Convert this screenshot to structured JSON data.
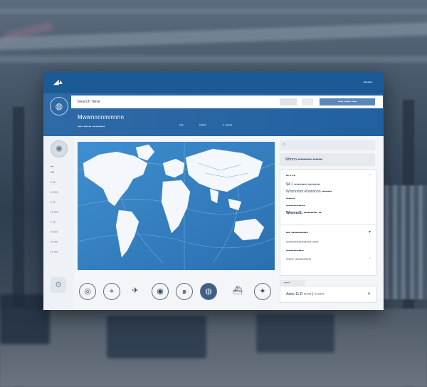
{
  "app": {
    "topbar_text": "▪▪▪▪▪▪",
    "search_placeholder": "Search here",
    "tools_label": "▪▪▪▪ ▪▪▪▪▪ ▪▪▪▪",
    "title": "Mwwnnnnmmnnn",
    "subtitle": "▪▪▪▪ ▪▪▪▪▪▪   ▪▪▪▪▪▪▪▪▪▪",
    "nav": [
      "▪▪▪",
      "▪▪▪▪▪",
      "▪ ▪▪▪▪▪"
    ]
  },
  "sidebar": {
    "items": [
      "▪▪",
      "▪▪▪",
      "▪ ▪▪",
      "▪▪ ▪▪▪",
      "▪ ▪▪",
      "▪▪ ▪▪▪",
      "▪ ▪▪",
      "▪▪ ▪▪▪",
      "▪▪ ▪▪▪",
      "▪▪ ▪▪▪"
    ]
  },
  "right": {
    "header": "Wtnnn  ▪▪▪▪▪▪▪▪▪▪  ▪▪▪▪▪▪▪",
    "card1": {
      "lines": [
        "▪▪ ▪ ▪▪",
        "$4.1 ▪▪▪▪▪▪▪▪▪▪ ▪▪▪▪▪▪▪▪▪▪",
        "Wnnnnmm Rnnnnnnn ▪▪▪▪▪▪▪▪",
        "▪▪▪▪▪▪▪",
        "▪▪▪▪▪▪▪▪▪▪▪▪▪▪▪",
        "Wnnnn5.  ▪▪▪▪▪▪▪▪▪▪ ▪▪"
      ]
    },
    "card2": {
      "lines": [
        "▪▪▪ ▪▪▪▪▪▪▪▪▪▪▪▪",
        "▪▪▪▪▪▪▪▪▪▪▪▪▪▪▪▪▪▪▪▪ ▪▪▪▪▪",
        "▪▪▪▪▪▪▪▪▪▪▪▪▪▪",
        "▪▪▪▪▪▪ ▪▪▪▪▪▪▪▪▪▪▪▪▪"
      ]
    },
    "footer_tab": "▪▪▪▪▪",
    "footer": "Adoo 11 D  ▪▪▪▪▪▪ |  ▪▪ ▪▪▪▪▪"
  },
  "icons": [
    "compass-icon",
    "location-pin-icon",
    "bird-icon",
    "satellite-icon",
    "storm-icon",
    "globe-icon",
    "ship-icon",
    "navigation-icon"
  ]
}
